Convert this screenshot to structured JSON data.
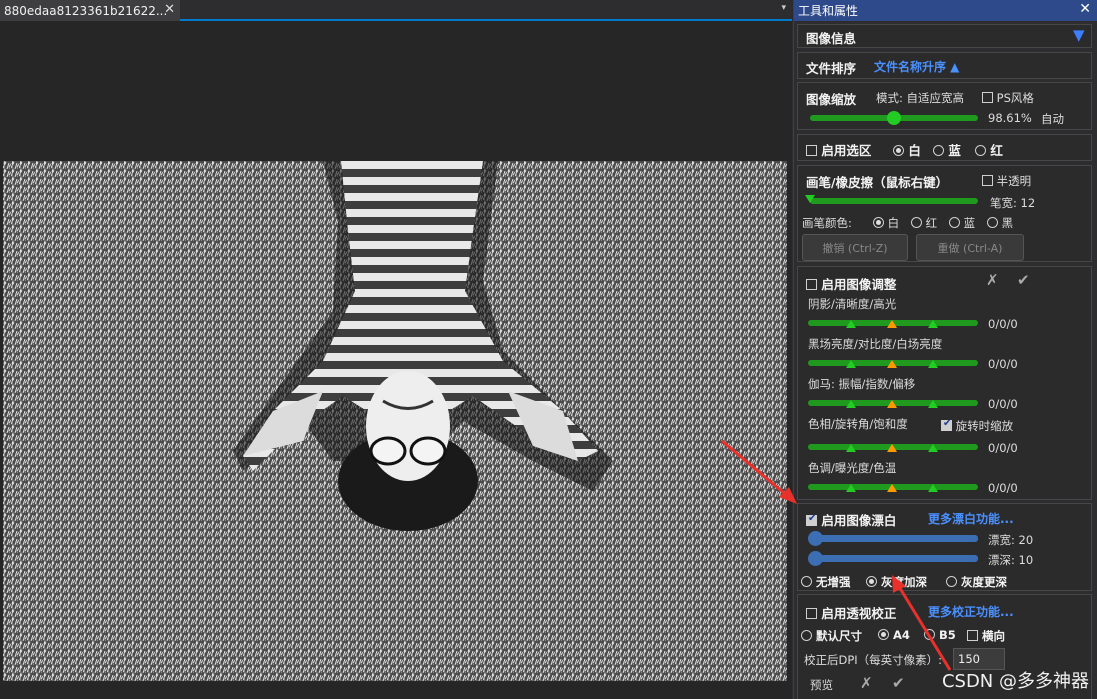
{
  "document": {
    "tab_title": "880edaa8123361b21622...",
    "tab_close": "✕",
    "tab_dropdown": "▾"
  },
  "panel": {
    "title": "工具和属性",
    "close": "✕",
    "image_info": {
      "label": "图像信息",
      "toggle": "▼"
    },
    "file_sort": {
      "label": "文件排序",
      "value": "文件名称升序 ▲"
    },
    "zoom": {
      "label": "图像缩放",
      "mode": "模式: 自适应宽高",
      "ps_style": "PS风格",
      "percent": "98.61%",
      "auto": "自动",
      "level": 0.5
    },
    "selection": {
      "label": "启用选区",
      "options": [
        "白",
        "蓝",
        "红"
      ],
      "selected": "白"
    },
    "brush": {
      "label": "画笔/橡皮擦（鼠标右键）",
      "translucent": "半透明",
      "width_label": "笔宽: 12",
      "color_label": "画笔颜色:",
      "colors": [
        "白",
        "红",
        "蓝",
        "黑"
      ],
      "selected": "白",
      "undo": "撤销 (Ctrl-Z)",
      "redo": "重做 (Ctrl-A)"
    },
    "adjust": {
      "label": "启用图像调整",
      "cancel": "✗",
      "confirm": "✔",
      "rows": [
        {
          "label": "阴影/清晰度/高光",
          "value": "0/0/0"
        },
        {
          "label": "黑场亮度/对比度/白场亮度",
          "value": "0/0/0"
        },
        {
          "label": "伽马: 振幅/指数/偏移",
          "value": "0/0/0"
        },
        {
          "label": "色相/旋转角/饱和度",
          "value": "0/0/0",
          "extra": "旋转时缩放"
        },
        {
          "label": "色调/曝光度/色温",
          "value": "0/0/0"
        }
      ]
    },
    "whiten": {
      "label": "启用图像漂白",
      "more": "更多漂白功能...",
      "width_label": "漂宽: 20",
      "depth_label": "漂深: 10",
      "modes": [
        "无增强",
        "灰度加深",
        "灰度更深"
      ],
      "selected": "灰度加深"
    },
    "perspective": {
      "label": "启用透视校正",
      "more": "更多校正功能...",
      "sizes": [
        "默认尺寸",
        "A4",
        "B5"
      ],
      "selected": "A4",
      "landscape": "横向",
      "dpi_label": "校正后DPI（每英寸像素）:",
      "dpi_value": "150",
      "preview": "预览",
      "cancel": "✗",
      "confirm": "✔"
    }
  },
  "watermark": "CSDN @多多神器",
  "colors": {
    "accent_blue": "#4a90ff",
    "slider_green": "#1f9a1f",
    "arrow_red": "#e8312a"
  }
}
